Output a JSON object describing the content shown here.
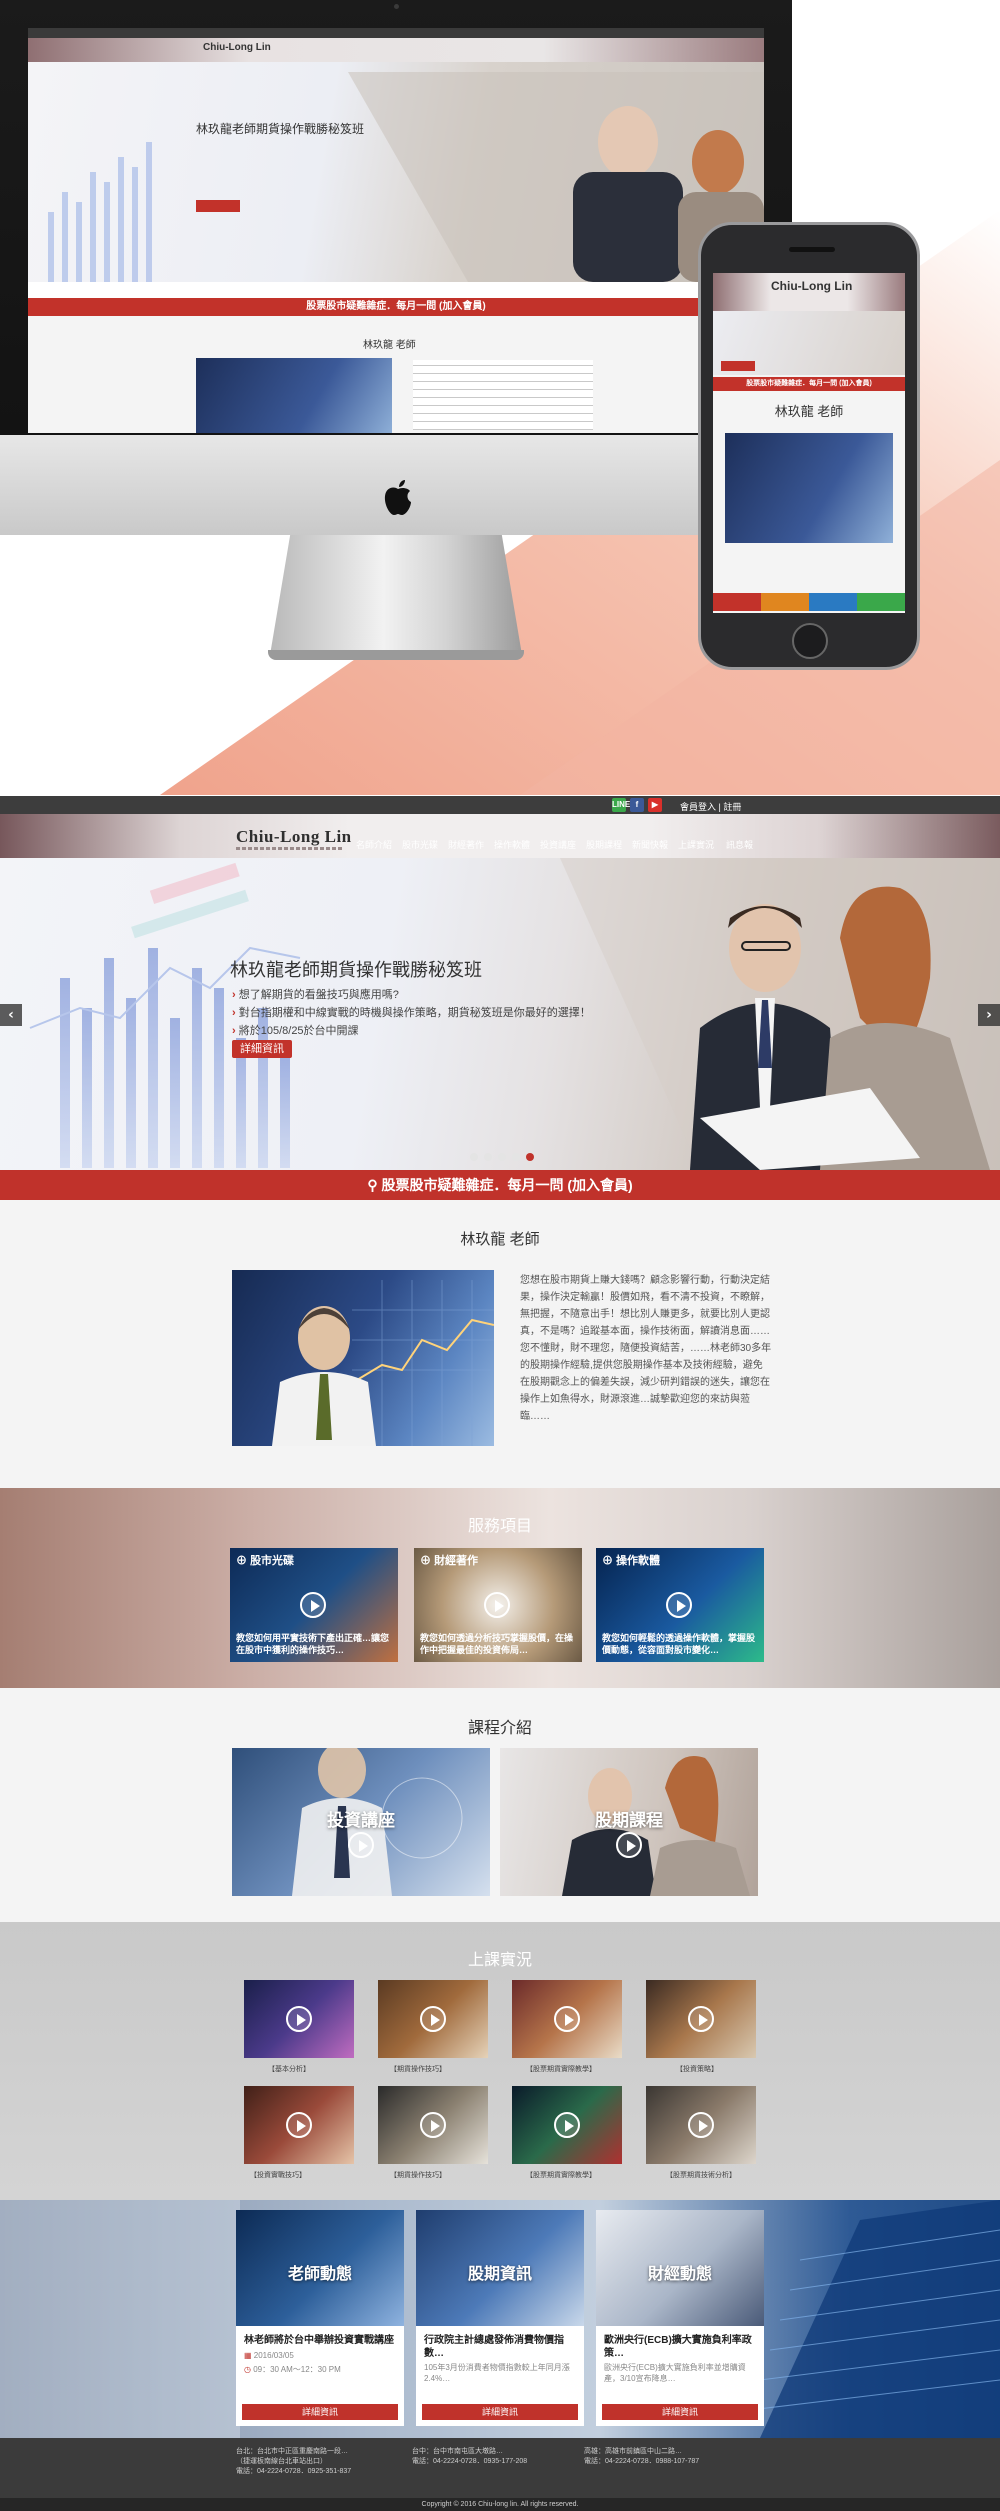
{
  "mockup": {
    "mini_logo": "Chiu-Long Lin",
    "mini_hero_title": "林玖龍老師期貨操作戰勝秘笈班",
    "mini_redbar": "股票股市疑難雜症．每月一問 (加入會員)",
    "mini_teacher": "林玖龍 老師",
    "phone_logo": "Chiu-Long Lin",
    "phone_redbar": "股票股市疑難雜症．每月一問 (加入會員)",
    "phone_teacher": "林玖龍 老師"
  },
  "topbar": {
    "line_label": "LINE",
    "login_text": "會員登入 | 註冊"
  },
  "nav": {
    "logo": "Chiu-Long Lin",
    "items": [
      "名師介紹",
      "股市光碟",
      "財經著作",
      "操作軟體",
      "投資講座",
      "股期課程",
      "新聞快報",
      "上課實況",
      "訊息報"
    ]
  },
  "hero": {
    "title": "林玖龍老師期貨操作戰勝秘笈班",
    "bullets": [
      "想了解期貨的看盤技巧與應用嗎?",
      "對台指期權和中線實戰的時機與操作策略，期貨秘笈班是你最好的選擇！",
      "將於105/8/25於台中開課"
    ],
    "button": "詳細資訊",
    "prev": "‹",
    "next": "›"
  },
  "redbar": {
    "text": "股票股市疑難雜症．每月一問 (加入會員)"
  },
  "teacher": {
    "title": "林玖龍 老師",
    "bio": "您想在股市期貨上賺大錢嗎？顧念影響行動，行動決定結果，操作決定輸贏！股價如飛，看不清不投資，不瞭解，無把握，不隨意出手！想比別人賺更多，就要比別人更認真，不是嗎？追蹤基本面，操作技術面，解讀消息面……您不懂財，財不理您，隨便投資結苦，……林老師30多年的股期操作經驗,提供您股期操作基本及技術經驗，避免在股期觀念上的偏差失誤，減少研判錯誤的迷失，讓您在操作上如魚得水，財源滾進…誠摯歡迎您的來訪與蒞臨……"
  },
  "services": {
    "title": "服務項目",
    "items": [
      {
        "label": "股市光碟",
        "desc": "教您如何用平實技術下產出正確…讓您在股市中獲利的操作技巧…"
      },
      {
        "label": "財經著作",
        "desc": "教您如何透過分析技巧掌握股價，在操作中把握最佳的投資佈局…"
      },
      {
        "label": "操作軟體",
        "desc": "教您如何輕鬆的透過操作軟體，掌握股價動態，從容面對股市變化…"
      }
    ]
  },
  "courses": {
    "title": "課程介紹",
    "items": [
      "投資講座",
      "股期課程"
    ]
  },
  "videos": {
    "title": "上課實況",
    "items": [
      "【基本分析】",
      "【期貨操作技巧】",
      "【股票期貨實際教學】",
      "【投資策略】",
      "【投資實戰技巧】",
      "【期貨操作技巧】",
      "【股票期貨實際教學】",
      "【股票期貨技術分析】"
    ]
  },
  "news": {
    "items": [
      {
        "image_label": "老師動態",
        "title": "林老師將於台中舉辦投資實戰講座",
        "meta": [
          "2016/03/05",
          "09：30 AM～12：30 PM"
        ],
        "button": "詳細資訊"
      },
      {
        "image_label": "股期資訊",
        "title": "行政院主計總處發佈消費物價指數…",
        "meta": [
          "105年3月份消費者物價指數較上年同月漲2.4%…"
        ],
        "button": "詳細資訊"
      },
      {
        "image_label": "財經動態",
        "title": "歐洲央行(ECB)擴大實施負利率政策…",
        "meta": [
          "歐洲央行(ECB)擴大實施負利率並增購資產，3/10宣布降息…"
        ],
        "button": "詳細資訊"
      }
    ]
  },
  "footer": {
    "col1": [
      "台北：台北市中正區重慶南路一段…",
      "（捷運板南線台北車站出口）",
      "電話：04-2224-0728．0925-351-837"
    ],
    "col2": [
      "台中：台中市南屯區大墩路…",
      "電話：04-2224-0728．0935-177-208"
    ],
    "col3": [
      "高雄：高雄市前鎮區中山二路…",
      "電話：04-2224-0728．0988-107-787"
    ],
    "copyright": "Copyright © 2016 Chiu-long lin. All rights reserved."
  }
}
